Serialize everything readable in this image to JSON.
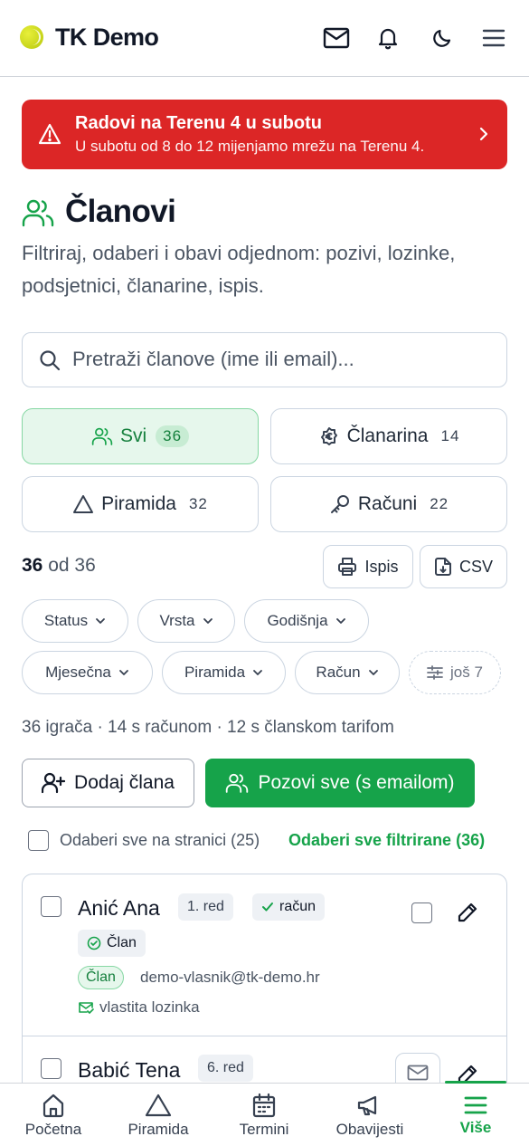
{
  "header": {
    "app_title": "TK Demo",
    "icons": [
      "mail-icon",
      "bell-icon",
      "moon-icon",
      "menu-icon"
    ]
  },
  "alert": {
    "title": "Radovi na Terenu 4 u subotu",
    "text": "U subotu od 8 do 12 mijenjamo mrežu na Terenu 4.",
    "color": "#dc2626"
  },
  "page": {
    "title": "Članovi",
    "subtitle": "Filtriraj, odaberi i obavi odjednom: pozivi, lozinke, podsjetnici, članarine, ispis."
  },
  "search": {
    "placeholder": "Pretraži članove (ime ili email)...",
    "value": ""
  },
  "segments": [
    {
      "label": "Svi",
      "count": "36",
      "icon": "users-icon",
      "active": true
    },
    {
      "label": "Članarina",
      "count": "14",
      "icon": "euro-icon",
      "active": false
    },
    {
      "label": "Piramida",
      "count": "32",
      "icon": "triangle-icon",
      "active": false
    },
    {
      "label": "Računi",
      "count": "22",
      "icon": "key-icon",
      "active": false
    }
  ],
  "results": {
    "shown": "36",
    "of_text": "od 36",
    "print_label": "Ispis",
    "csv_label": "CSV"
  },
  "filters": [
    {
      "label": "Status"
    },
    {
      "label": "Vrsta"
    },
    {
      "label": "Godišnja"
    },
    {
      "label": "Mjesečna"
    },
    {
      "label": "Piramida"
    },
    {
      "label": "Račun"
    },
    {
      "label": "još 7"
    }
  ],
  "summary": "36 igrača · 14 s računom · 12 s članskom tarifom",
  "actions": {
    "add_label": "Dodaj člana",
    "invite_label": "Pozovi sve (s emailom)"
  },
  "selection": {
    "select_page_label": "Odaberi sve na stranici (25)",
    "select_filtered_label": "Odaberi sve filtrirane (36)"
  },
  "members": [
    {
      "name": "Anić Ana",
      "rank": "1. red",
      "account_badge": "račun",
      "member_badge": "Član",
      "tag": "Član",
      "email": "demo-vlasnik@tk-demo.hr",
      "password_status": "vlastita lozinka"
    },
    {
      "name": "Babić Tena",
      "rank": "6. red"
    }
  ],
  "bottom_nav": [
    {
      "label": "Početna",
      "icon": "home-icon",
      "active": false
    },
    {
      "label": "Piramida",
      "icon": "triangle-icon",
      "active": false
    },
    {
      "label": "Termini",
      "icon": "calendar-icon",
      "active": false
    },
    {
      "label": "Obavijesti",
      "icon": "megaphone-icon",
      "active": false
    },
    {
      "label": "Više",
      "icon": "menu-icon",
      "active": true
    }
  ],
  "colors": {
    "accent": "#16a34a",
    "accent_light": "#e6f7ec",
    "danger": "#dc2626",
    "border": "#cbd5e1"
  }
}
